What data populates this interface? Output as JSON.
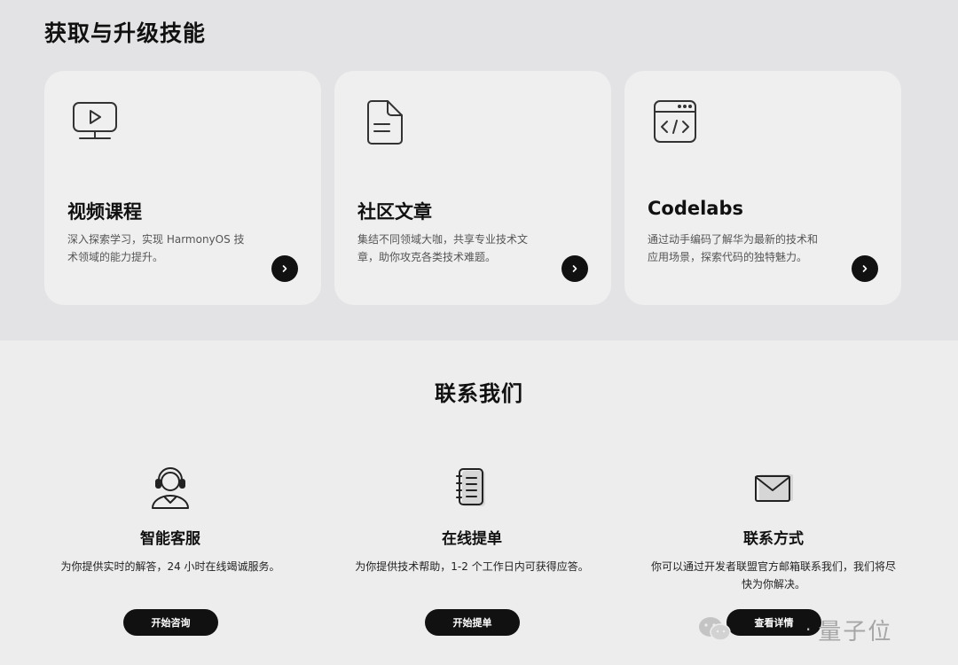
{
  "skills": {
    "title": "获取与升级技能",
    "cards": [
      {
        "title": "视频课程",
        "description": "深入探索学习，实现 HarmonyOS 技术领域的能力提升。",
        "icon": "video-screen-icon",
        "arrow": "›"
      },
      {
        "title": "社区文章",
        "description": "集结不同领域大咖，共享专业技术文章，助你攻克各类技术难题。",
        "icon": "document-icon",
        "arrow": "›"
      },
      {
        "title": "Codelabs",
        "description": "通过动手编码了解华为最新的技术和应用场景，探索代码的独特魅力。",
        "icon": "code-window-icon",
        "arrow": "›"
      }
    ]
  },
  "contact": {
    "title": "联系我们",
    "items": [
      {
        "name": "智能客服",
        "description": "为你提供实时的解答，24 小时在线竭诚服务。",
        "button": "开始咨询",
        "icon": "customer-service-icon"
      },
      {
        "name": "在线提单",
        "description": "为你提供技术帮助，1-2 个工作日内可获得应答。",
        "button": "开始提单",
        "icon": "notebook-icon"
      },
      {
        "name": "联系方式",
        "description": "你可以通过开发者联盟官方邮箱联系我们，我们将尽快为你解决。",
        "button": "查看详情",
        "icon": "mail-icon"
      }
    ]
  },
  "watermark": {
    "text": "量子位",
    "separator": "·",
    "icon": "wechat-icon"
  },
  "colors": {
    "top_background": "#e3e3e5",
    "bottom_background": "#ededed",
    "card_background": "#efefef",
    "button": "#111111"
  }
}
